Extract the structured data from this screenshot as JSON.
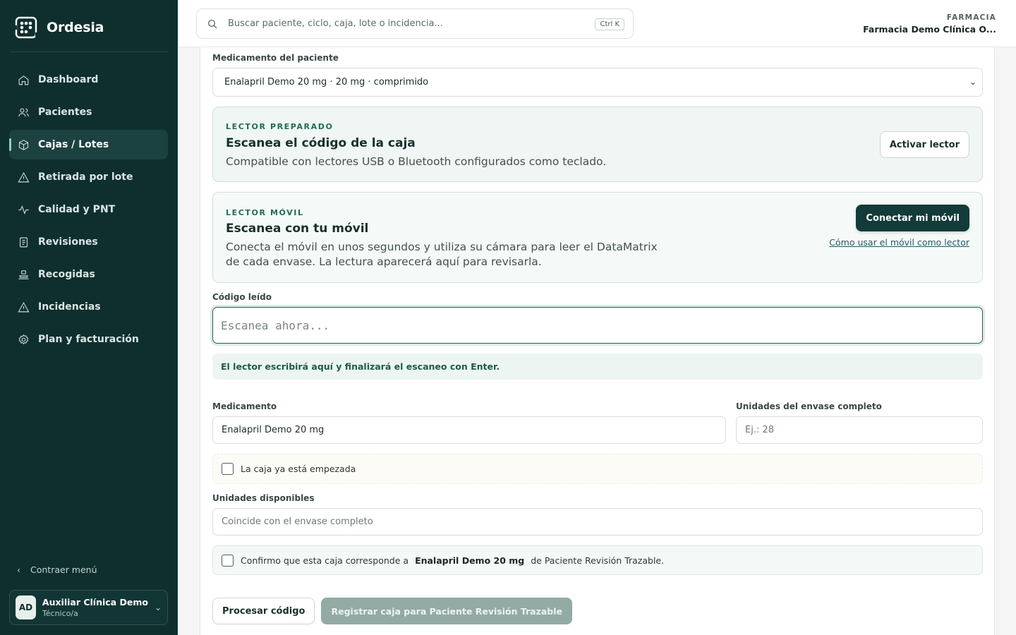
{
  "brand": {
    "name": "Ordesia"
  },
  "sidebar": {
    "items": [
      {
        "label": "Dashboard",
        "icon": "home-icon"
      },
      {
        "label": "Pacientes",
        "icon": "users-icon"
      },
      {
        "label": "Cajas / Lotes",
        "icon": "box-icon",
        "active": true
      },
      {
        "label": "Retirada por lote",
        "icon": "warning-icon"
      },
      {
        "label": "Calidad y PNT",
        "icon": "activity-icon"
      },
      {
        "label": "Revisiones",
        "icon": "clipboard-icon"
      },
      {
        "label": "Recogidas",
        "icon": "pickup-icon"
      },
      {
        "label": "Incidencias",
        "icon": "alert-icon"
      },
      {
        "label": "Plan y facturación",
        "icon": "settings-icon"
      }
    ],
    "collapse_label": "Contraer menú",
    "user": {
      "initials": "AD",
      "name": "Auxiliar Clínica Demo",
      "role": "Técnico/a"
    }
  },
  "topbar": {
    "search_placeholder": "Buscar paciente, ciclo, caja, lote o incidencia...",
    "shortcut": "Ctrl K",
    "pharmacy_label": "FARMACIA",
    "pharmacy_name": "Farmacia Demo Clínica O..."
  },
  "form": {
    "patient_med_label": "Medicamento del paciente",
    "patient_med_value": "Enalapril Demo 20 mg · 20 mg · comprimido",
    "reader": {
      "eyebrow": "LECTOR PREPARADO",
      "title": "Escanea el código de la caja",
      "desc": "Compatible con lectores USB o Bluetooth configurados como teclado.",
      "button": "Activar lector"
    },
    "mobile": {
      "eyebrow": "LECTOR MÓVIL",
      "title": "Escanea con tu móvil",
      "desc_line1": "Conecta el móvil en unos segundos y utiliza su cámara para leer el DataMatrix",
      "desc_line2": "de cada envase. La lectura aparecerá aquí para revisarla.",
      "button": "Conectar mi móvil",
      "link": "Cómo usar el móvil como lector"
    },
    "code_label": "Código leído",
    "code_placeholder": "Escanea ahora...",
    "hint": "El lector escribirá aquí y finalizará el escaneo con Enter.",
    "medication_label": "Medicamento",
    "medication_value": "Enalapril Demo 20 mg",
    "units_label": "Unidades del envase completo",
    "units_placeholder": "Ej.: 28",
    "started_label": "La caja ya está empezada",
    "available_label": "Unidades disponibles",
    "available_placeholder": "Coincide con el envase completo",
    "confirm_prefix": "Confirmo que esta caja corresponde a",
    "confirm_med": "Enalapril Demo 20 mg",
    "confirm_suffix": "de Paciente Revisión Trazable.",
    "process_button": "Procesar código",
    "register_button": "Registrar caja para Paciente Revisión Trazable"
  },
  "colors": {
    "sidebar_bg": "#0f2f2f",
    "accent_dark": "#123b39",
    "panel_green": "#eff6f3"
  }
}
